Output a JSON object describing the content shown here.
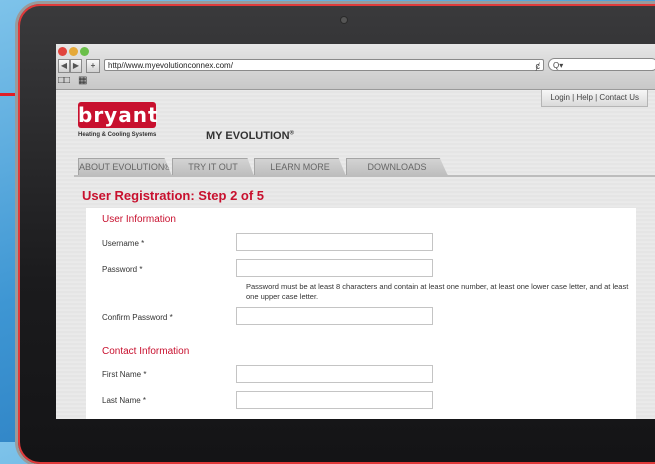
{
  "browser": {
    "url": "http//www.myevolutionconnex.com/",
    "reload_icon": "ȼ",
    "search_placeholder": "Q▾",
    "back": "◀",
    "forward": "▶",
    "add": "+",
    "bookmarks_icon": "□□",
    "grid_icon": "▦"
  },
  "header": {
    "top_links": "Login  |  Help  |  Contact Us",
    "logo_word": "bryant",
    "logo_tagline": "Heating & Cooling Systems",
    "product": "MY EVOLUTION",
    "product_mark": "®"
  },
  "tabs": [
    "ABOUT EVOLUTION®",
    "TRY IT OUT",
    "LEARN MORE",
    "DOWNLOADS"
  ],
  "page_title": "User Registration: Step 2 of 5",
  "form": {
    "user_section": "User Information",
    "username_label": "Username *",
    "password_label": "Password *",
    "password_hint": "Password must be at least 8 characters and contain at least one number, at least one lower case letter, and at least one upper case letter.",
    "confirm_label": "Confirm Password *",
    "contact_section": "Contact Information",
    "first_name_label": "First Name *",
    "last_name_label": "Last Name *"
  },
  "colors": {
    "brand_red": "#c8102e",
    "background_blue": "#3e96d3"
  }
}
